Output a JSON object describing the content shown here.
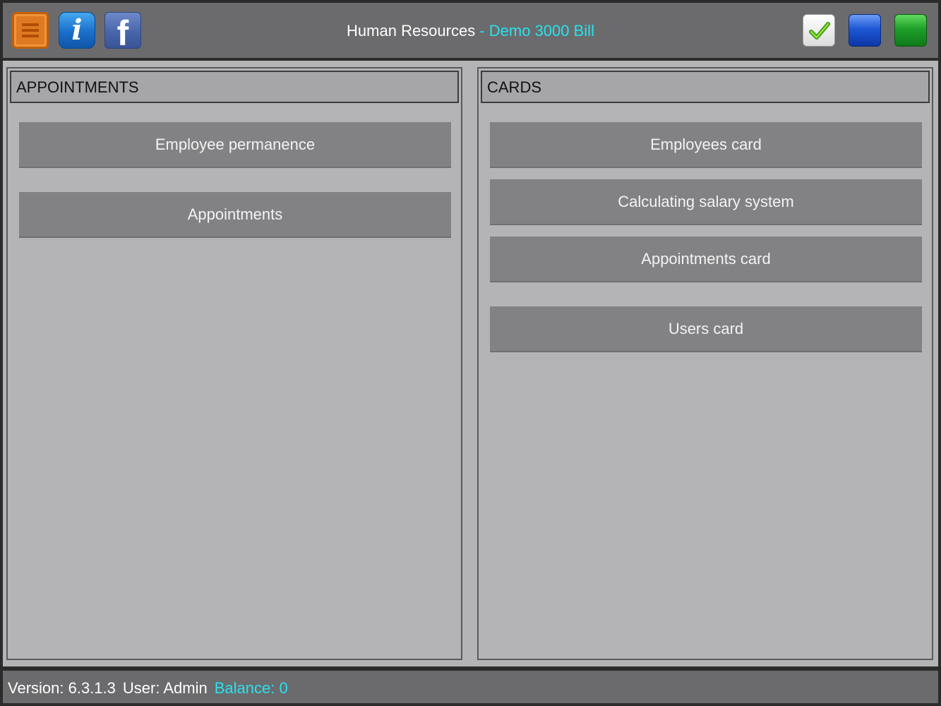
{
  "header": {
    "title": "Human Resources",
    "subtitle": " - Demo 3000 Bill",
    "icons": {
      "menu": "menu-icon",
      "info": "info-icon",
      "facebook": "facebook-icon",
      "check": "checkmark-icon",
      "blue": "blue-square-icon",
      "green": "green-square-icon"
    },
    "info_glyph": "i",
    "fb_glyph": "f",
    "accent_color": "#27e3ee"
  },
  "appointments": {
    "heading": "APPOINTMENTS",
    "buttons": [
      "Employee permanence",
      "Appointments"
    ]
  },
  "cards": {
    "heading": "CARDS",
    "buttons": [
      "Employees card",
      "Calculating salary system",
      "Appointments card",
      "Users card"
    ]
  },
  "footer": {
    "version": "Version: 6.3.1.3",
    "user": "User: Admin",
    "balance": "Balance: 0"
  }
}
